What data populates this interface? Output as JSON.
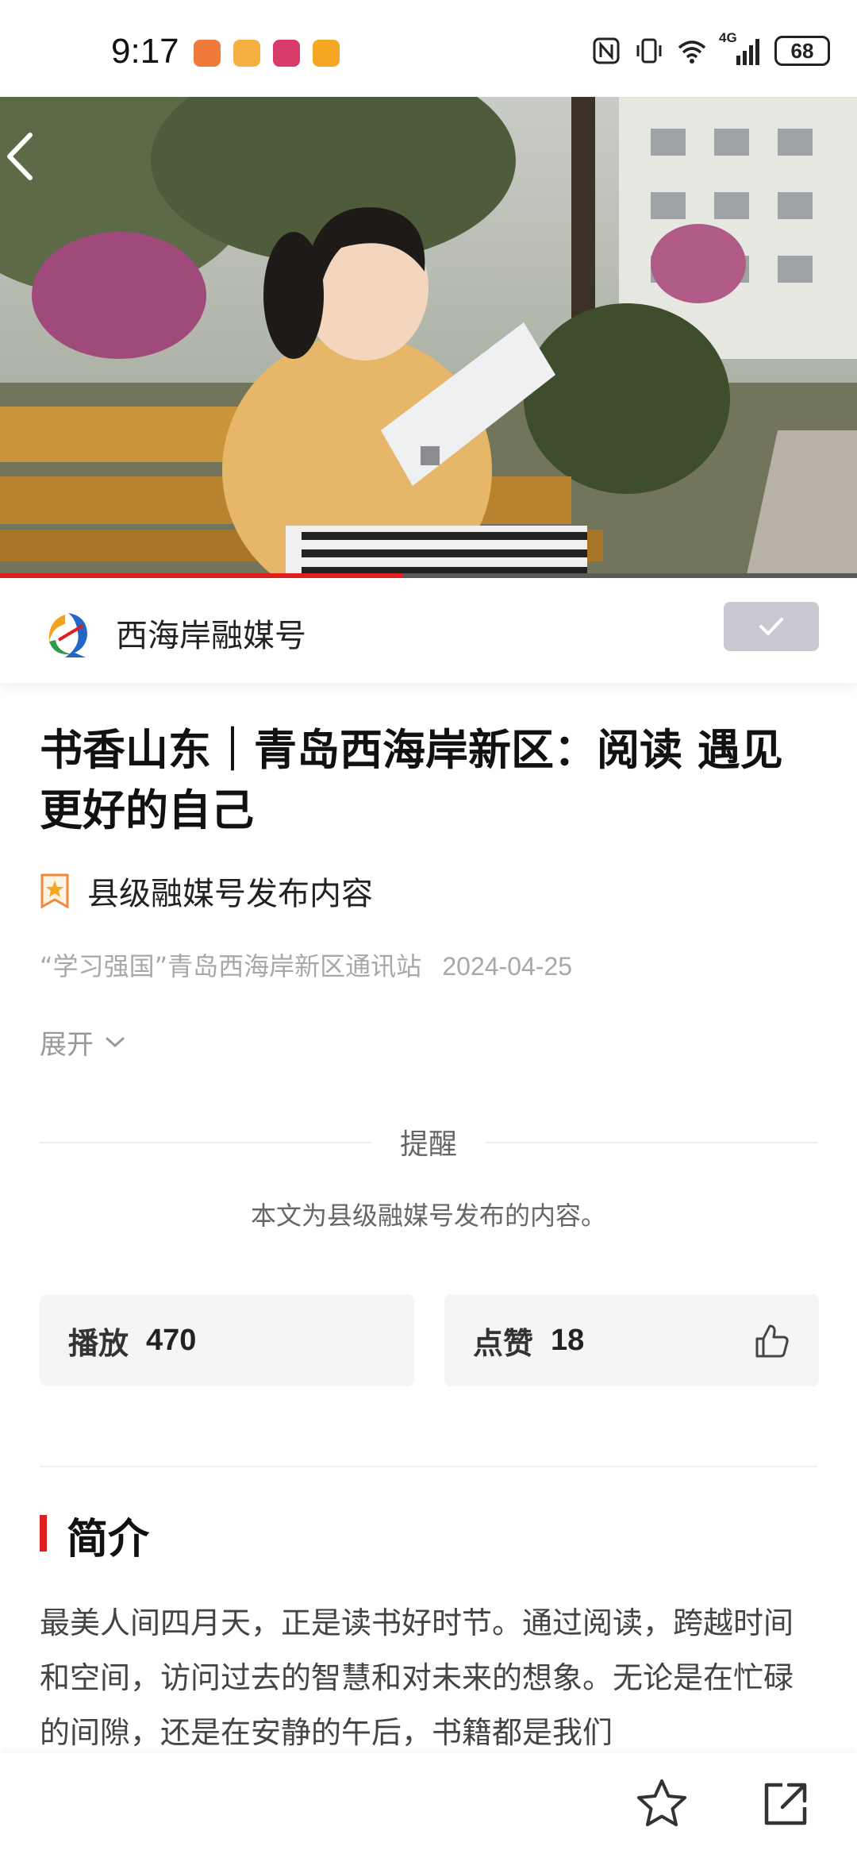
{
  "status_bar": {
    "time": "9:17",
    "battery": "68",
    "network": "4G"
  },
  "player": {
    "progress_fraction": 0.47,
    "accent": "#e02020"
  },
  "channel": {
    "name": "西海岸融媒号"
  },
  "article": {
    "title": "书香山东｜青岛西海岸新区：阅读 遇见更好的自己",
    "badge": "县级融媒号发布内容",
    "source": "“学习强国”青岛西海岸新区通讯站",
    "date": "2024-04-25",
    "expand_label": "展开"
  },
  "reminder": {
    "title": "提醒",
    "text": "本文为县级融媒号发布的内容。"
  },
  "stats": {
    "plays_label": "播放",
    "plays_value": "470",
    "likes_label": "点赞",
    "likes_value": "18"
  },
  "intro": {
    "heading": "简介",
    "text": "最美人间四月天，正是读书好时节。通过阅读，跨越时间和空间，访问过去的智慧和对未来的想象。无论是在忙碌的间隙，还是在安静的午后，书籍都是我们"
  },
  "icons": {
    "back": "chevron-left-icon",
    "follow": "check-icon",
    "badge": "bookmark-star-icon",
    "like": "thumbs-up-icon",
    "favorite": "star-icon",
    "share": "share-icon"
  }
}
